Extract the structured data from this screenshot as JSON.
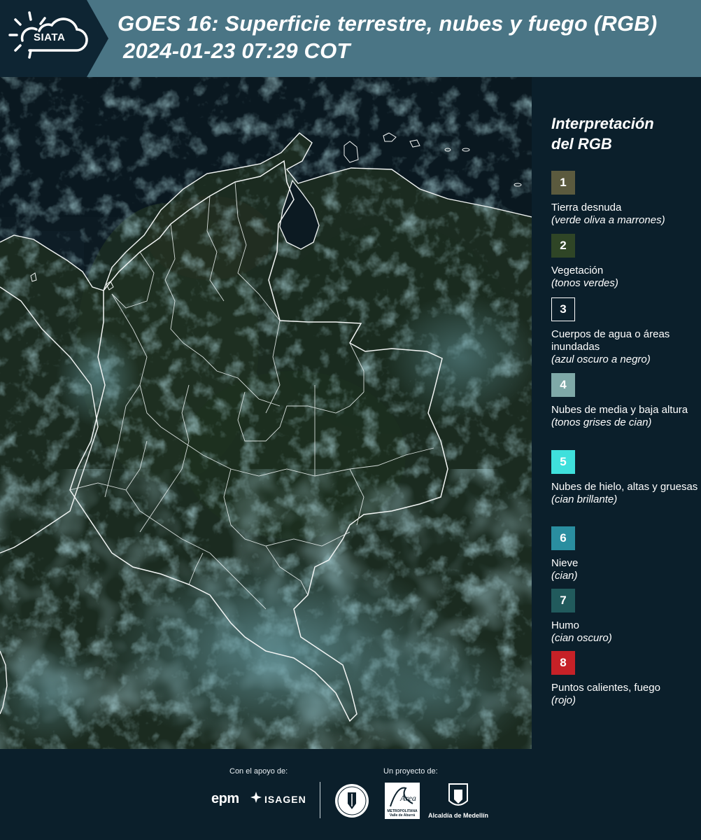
{
  "header": {
    "logo_text": "SIATA",
    "title_line1": "GOES 16: Superficie terrestre, nubes y fuego (RGB)",
    "title_line2": "2024-01-23 07:29 COT"
  },
  "map": {
    "icon": "satellite-map",
    "colors": {
      "land": "#1b2b20",
      "ocean": "#0c1a22",
      "cloud": "#4a7f8a",
      "border": "#f2f5f4"
    }
  },
  "legend": {
    "title_line1": "Interpretación",
    "title_line2": "del RGB",
    "items": [
      {
        "number": "1",
        "label": "Tierra desnuda",
        "note": "(verde oliva a marrones)",
        "color": "#5b5a3e"
      },
      {
        "number": "2",
        "label": "Vegetación",
        "note": "(tonos verdes)",
        "color": "#2f4526"
      },
      {
        "number": "3",
        "label": "Cuerpos de agua o áreas inundadas",
        "note": "(azul oscuro a negro)",
        "color": "#0b1f2b"
      },
      {
        "number": "4",
        "label": "Nubes de media y baja altura",
        "note": "(tonos grises de cian)",
        "color": "#7fa9a8"
      },
      {
        "number": "5",
        "label": "Nubes de hielo, altas y gruesas",
        "note": "(cian brillante)",
        "color": "#3fe0dc"
      },
      {
        "number": "6",
        "label": "Nieve",
        "note": "(cian)",
        "color": "#2a8ea0"
      },
      {
        "number": "7",
        "label": "Humo",
        "note": "(cian oscuro)",
        "color": "#215a5c"
      },
      {
        "number": "8",
        "label": "Puntos calientes, fuego",
        "note": "(rojo)",
        "color": "#c62127"
      }
    ]
  },
  "footer": {
    "support_label": "Con el apoyo de:",
    "project_label": "Un proyecto de:",
    "epm": "epm",
    "isagen": "ISAGEN",
    "area_logo_text": "Área",
    "area_subtext": "METROPOLITANA Valle de Aburrá",
    "medellin": "Alcaldía de Medellín"
  }
}
